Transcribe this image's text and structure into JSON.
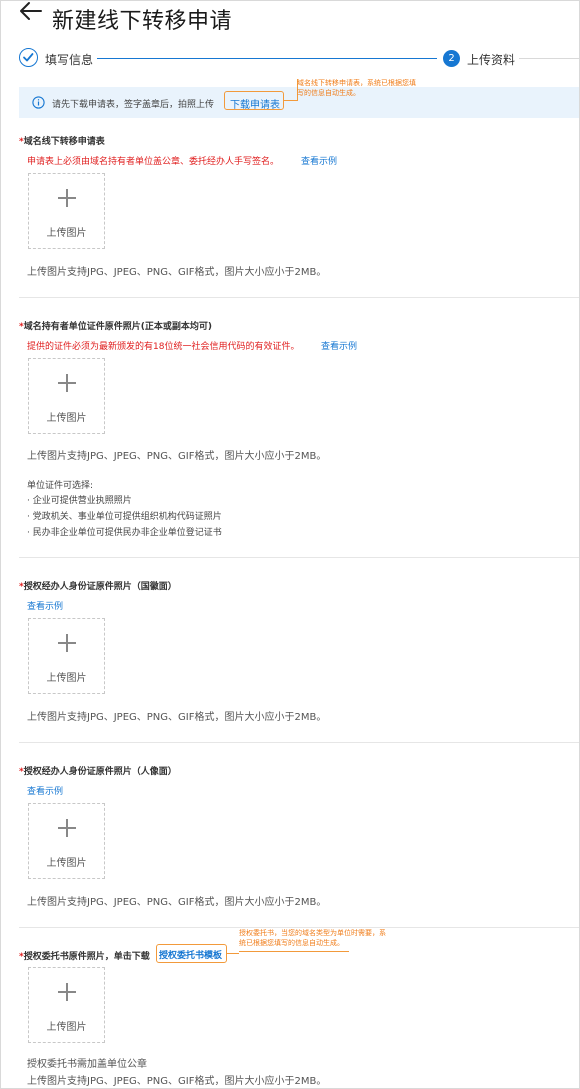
{
  "header": {
    "title": "新建线下转移申请"
  },
  "steps": [
    {
      "label": "填写信息",
      "state": "done"
    },
    {
      "index": "2",
      "label": "上传资料",
      "state": "active"
    }
  ],
  "info": {
    "text": "请先下载申请表，签字盖章后，拍照上传",
    "link": "下载申请表",
    "annotation": "域名线下转移申请表，系统已根据您填写的信息自动生成。"
  },
  "upload_label": "上传图片",
  "format_hint": "上传图片支持JPG、JPEG、PNG、GIF格式，图片大小应小于2MB。",
  "sections": [
    {
      "title": "域名线下转移申请表",
      "note": "申请表上必须由域名持有者单位盖公章、委托经办人手写签名。",
      "example": "查看示例"
    },
    {
      "title": "域名持有者单位证件原件照片(正本或副本均可)",
      "note": "提供的证件必须为最新颁发的有18位统一社会信用代码的有效证件。",
      "example": "查看示例",
      "extra_title": "单位证件可选择:",
      "extra_items": [
        "· 企业可提供营业执照照片",
        "· 党政机关、事业单位可提供组织机构代码证照片",
        "· 民办非企业单位可提供民办非企业单位登记证书"
      ]
    },
    {
      "title": "授权经办人身份证原件照片（国徽面）",
      "example": "查看示例"
    },
    {
      "title": "授权经办人身份证原件照片（人像面）",
      "example": "查看示例"
    },
    {
      "title": "授权委托书原件照片，单击下载",
      "link": "授权委托书模板",
      "annotation": "授权委托书，当您的域名类型为单位时需要，系统已根据您填写的信息自动生成。",
      "note2": "授权委托书需加盖单位公章"
    }
  ],
  "colors": {
    "primary": "#1677d2",
    "required": "#e02020",
    "annotation": "#f29a3b",
    "info_bg": "#e9f3fc"
  }
}
